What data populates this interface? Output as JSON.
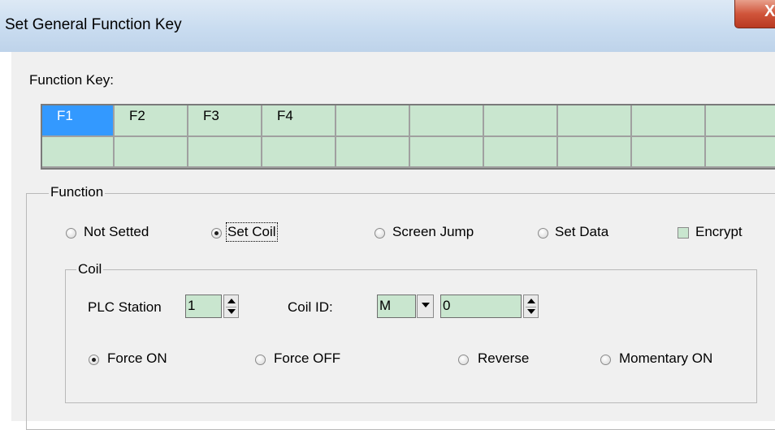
{
  "window": {
    "title": "Set General Function Key",
    "close_label": "X"
  },
  "function_key": {
    "label": "Function Key:",
    "row1": [
      "F1",
      "F2",
      "F3",
      "F4",
      "",
      "",
      "",
      "",
      "",
      ""
    ],
    "row2": [
      "",
      "",
      "",
      "",
      "",
      "",
      "",
      "",
      "",
      ""
    ],
    "selected": "F1"
  },
  "function_group": {
    "caption": "Function",
    "options": [
      "Not Setted",
      "Set Coil",
      "Screen Jump",
      "Set Data"
    ],
    "selected": "Set Coil",
    "encrypt_label": "Encrypt",
    "encrypt_checked": false
  },
  "coil_group": {
    "caption": "Coil",
    "plc_station_label": "PLC Station",
    "plc_station_value": "1",
    "coil_id_label": "Coil ID:",
    "coil_type_value": "M",
    "coil_number_value": "0",
    "modes": [
      "Force ON",
      "Force OFF",
      "Reverse",
      "Momentary ON"
    ],
    "selected_mode": "Force ON"
  },
  "colors": {
    "field_green": "#c9e6cf",
    "selection_blue": "#3399ff"
  }
}
